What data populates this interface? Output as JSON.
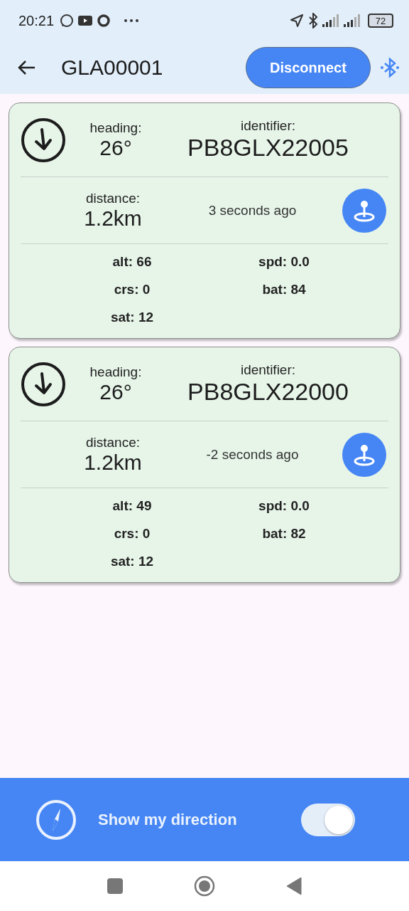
{
  "status_bar": {
    "time": "20:21",
    "battery": "72"
  },
  "app_bar": {
    "title": "GLA00001",
    "button": "Disconnect"
  },
  "devices": [
    {
      "heading_label": "heading:",
      "heading": "26°",
      "identifier_label": "identifier:",
      "identifier": "PB8GLX22005",
      "distance_label": "distance:",
      "distance": "1.2km",
      "updated": "3 seconds ago",
      "stats": [
        "alt: 66",
        "spd: 0.0",
        "crs: 0",
        "bat: 84",
        "sat: 12"
      ]
    },
    {
      "heading_label": "heading:",
      "heading": "26°",
      "identifier_label": "identifier:",
      "identifier": "PB8GLX22000",
      "distance_label": "distance:",
      "distance": "1.2km",
      "updated": "-2 seconds ago",
      "stats": [
        "alt: 49",
        "spd: 0.0",
        "crs: 0",
        "bat: 82",
        "sat: 12"
      ]
    }
  ],
  "bottom_bar": {
    "label": "Show my direction",
    "on": true
  }
}
